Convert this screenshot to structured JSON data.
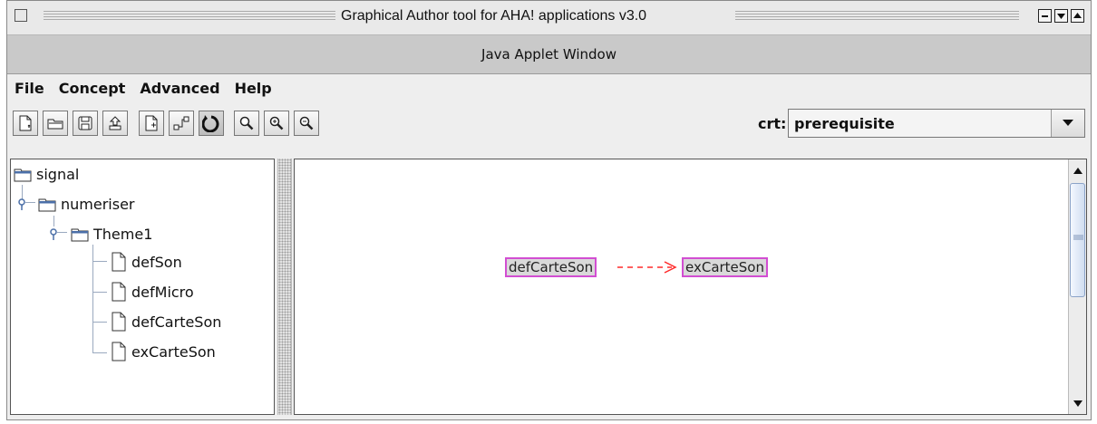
{
  "window": {
    "title": "Graphical Author tool for AHA! applications v3.0",
    "applet_label": "Java Applet Window",
    "controls": [
      "minimize-icon",
      "maximize-icon",
      "restore-icon"
    ]
  },
  "menubar": {
    "items": [
      {
        "label": "File"
      },
      {
        "label": "Concept"
      },
      {
        "label": "Advanced"
      },
      {
        "label": "Help"
      }
    ]
  },
  "toolbar": {
    "buttons": [
      {
        "icon": "new-file-icon"
      },
      {
        "icon": "open-folder-icon"
      },
      {
        "icon": "save-disk-icon"
      },
      {
        "icon": "export-upload-icon"
      },
      {
        "icon": "new-concept-icon"
      },
      {
        "icon": "add-relation-icon"
      },
      {
        "icon": "refresh-icon"
      },
      {
        "icon": "zoom-icon"
      },
      {
        "icon": "zoom-in-icon"
      },
      {
        "icon": "zoom-out-icon"
      }
    ],
    "crt_label": "crt:",
    "crt_value": "prerequisite"
  },
  "tree": {
    "nodes": [
      {
        "label": "signal",
        "type": "folder",
        "depth": 0
      },
      {
        "label": "numeriser",
        "type": "folder",
        "depth": 1
      },
      {
        "label": "Theme1",
        "type": "folder",
        "depth": 2
      },
      {
        "label": "defSon",
        "type": "file",
        "depth": 3
      },
      {
        "label": "defMicro",
        "type": "file",
        "depth": 3
      },
      {
        "label": "defCarteSon",
        "type": "file",
        "depth": 3
      },
      {
        "label": "exCarteSon",
        "type": "file",
        "depth": 3
      }
    ]
  },
  "graph": {
    "nodes": [
      {
        "label": "defCarteSon"
      },
      {
        "label": "exCarteSon"
      }
    ],
    "edge": {
      "from": "defCarteSon",
      "to": "exCarteSon",
      "style": "dashed",
      "color": "#ff2a2a"
    }
  },
  "colors": {
    "node_border": "#d24ed2",
    "node_fill": "#d9d9d9",
    "edge": "#ff2a2a",
    "scroll_thumb": "#d0ddf0"
  }
}
